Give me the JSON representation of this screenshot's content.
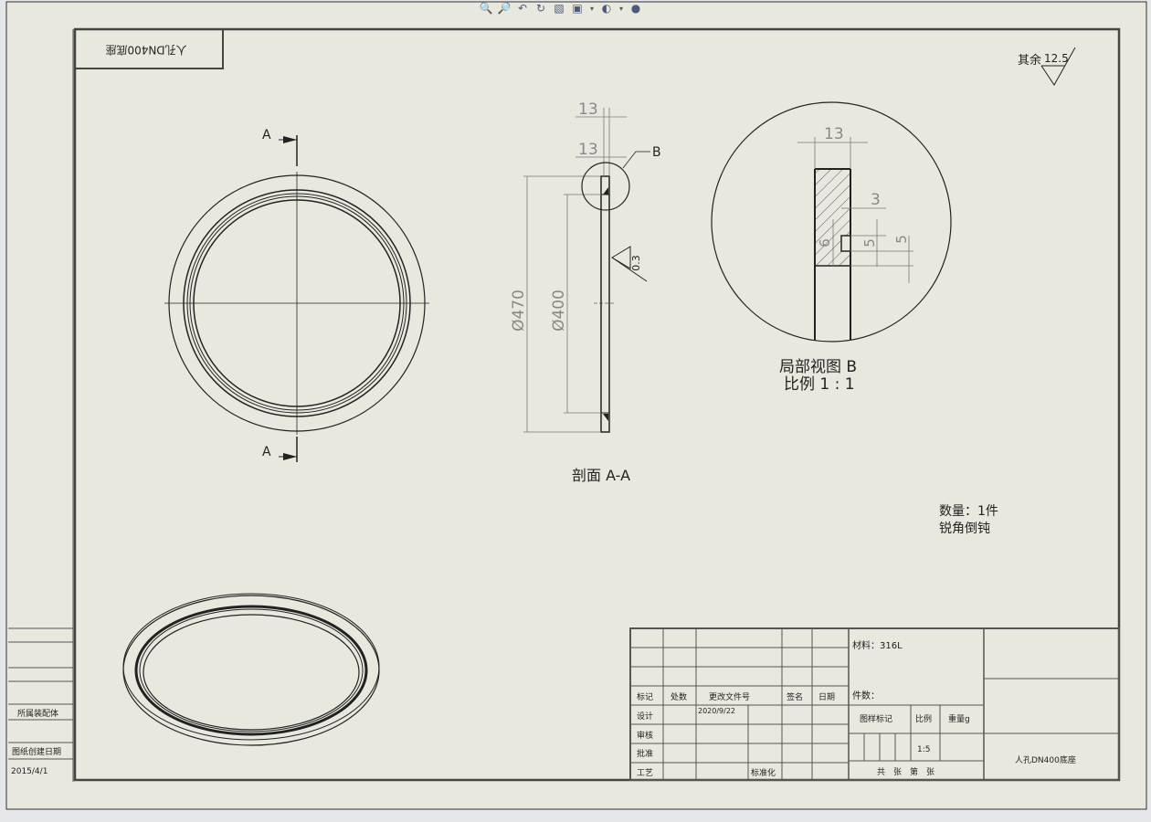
{
  "title_block_top": "人孔DN400底座",
  "roughness": {
    "label": "其余",
    "value": "12.5"
  },
  "section_marker": "A",
  "detail_marker": "B",
  "dims": {
    "top_13a": "13",
    "top_13b": "13",
    "dia_470": "Ø470",
    "dia_400": "Ø400",
    "chamfer": "0.3",
    "det_13": "13",
    "det_3": "3",
    "det_5a": "5",
    "det_5b": "5",
    "det_6": "6"
  },
  "section_caption": "剖面 A-A",
  "detail_caption_1": "局部视图 B",
  "detail_caption_2": "比例 1 : 1",
  "notes": {
    "qty": "数量：1件",
    "edge": "锐角倒钝"
  },
  "left_block": {
    "assembly": "所属装配体",
    "date_label": "图纸创建日期",
    "date": "2015/4/1"
  },
  "title_block": {
    "mark": "标记",
    "zone": "处数",
    "doc": "更改文件号",
    "sign": "签名",
    "date": "日期",
    "design": "设计",
    "design_date": "2020/9/22",
    "review": "审核",
    "approve": "批准",
    "process": "工艺",
    "standard": "标准化",
    "material": "材料：316L",
    "count": "件数：",
    "pattern_mark": "图样标记",
    "scale_label": "比例",
    "weight": "重量g",
    "scale": "1:5",
    "sheets": "共　张　第　张",
    "name": "人孔DN400底座"
  },
  "toolbar_icons": [
    "zoom-to-fit-icon",
    "zoom-area-icon",
    "previous-view-icon",
    "rotate-icon",
    "section-view-icon",
    "display-style-icon",
    "hide-show-icon",
    "appearance-icon"
  ]
}
